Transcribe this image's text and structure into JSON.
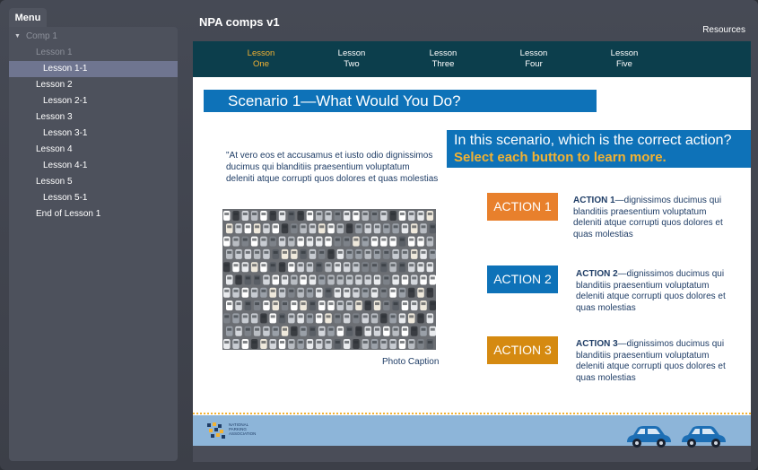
{
  "sidebar": {
    "menu_tab": "Menu",
    "items": [
      {
        "label": "Comp 1",
        "level": 0,
        "muted": true,
        "expanded": true
      },
      {
        "label": "Lesson 1",
        "level": 1,
        "muted": true
      },
      {
        "label": "Lesson 1-1",
        "level": 2,
        "selected": true
      },
      {
        "label": "Lesson 2",
        "level": 1
      },
      {
        "label": "Lesson 2-1",
        "level": 2
      },
      {
        "label": "Lesson 3",
        "level": 1
      },
      {
        "label": "Lesson 3-1",
        "level": 2
      },
      {
        "label": "Lesson 4",
        "level": 1
      },
      {
        "label": "Lesson 4-1",
        "level": 2
      },
      {
        "label": "Lesson 5",
        "level": 1
      },
      {
        "label": "Lesson 5-1",
        "level": 2
      },
      {
        "label": "End of Lesson 1",
        "level": 1
      }
    ]
  },
  "header": {
    "title": "NPA comps v1",
    "resources": "Resources"
  },
  "lesson_tabs": [
    {
      "line1": "Lesson",
      "line2": "One",
      "active": true
    },
    {
      "line1": "Lesson",
      "line2": "Two"
    },
    {
      "line1": "Lesson",
      "line2": "Three"
    },
    {
      "line1": "Lesson",
      "line2": "Four"
    },
    {
      "line1": "Lesson",
      "line2": "Five"
    }
  ],
  "slide": {
    "scenario_title": "Scenario 1—What Would You Do?",
    "question_line1": "In this scenario, which is the correct action?",
    "question_line2": "Select each button to learn more.",
    "intro_text": "\"At vero eos et accusamus et iusto odio dignissimos ducimus qui blanditiis praesentium voluptatum deleniti atque corrupti quos dolores et quas molestias",
    "photo_caption": "Photo Caption",
    "actions": [
      {
        "button": "ACTION 1",
        "title": "ACTION 1",
        "text": "—dignissimos ducimus qui blanditiis praesentium voluptatum deleniti atque corrupti quos dolores et quas molestias"
      },
      {
        "button": "ACTION 2",
        "title": "ACTION 2",
        "text": "—dignissimos ducimus qui blanditiis praesentium voluptatum deleniti atque corrupti quos dolores et quas molestias"
      },
      {
        "button": "ACTION 3",
        "title": "ACTION 3",
        "text": "—dignissimos ducimus qui blanditiis praesentium voluptatum deleniti atque corrupti quos dolores et quas molestias"
      }
    ],
    "footer_logo_lines": [
      "NATIONAL",
      "PARKING",
      "ASSOCIATION"
    ]
  },
  "colors": {
    "accent_blue": "#0e72b8",
    "accent_gold": "#f2b233",
    "lesson_bar": "#0c3e4c",
    "action1": "#e8802c",
    "action3": "#d58a11"
  }
}
